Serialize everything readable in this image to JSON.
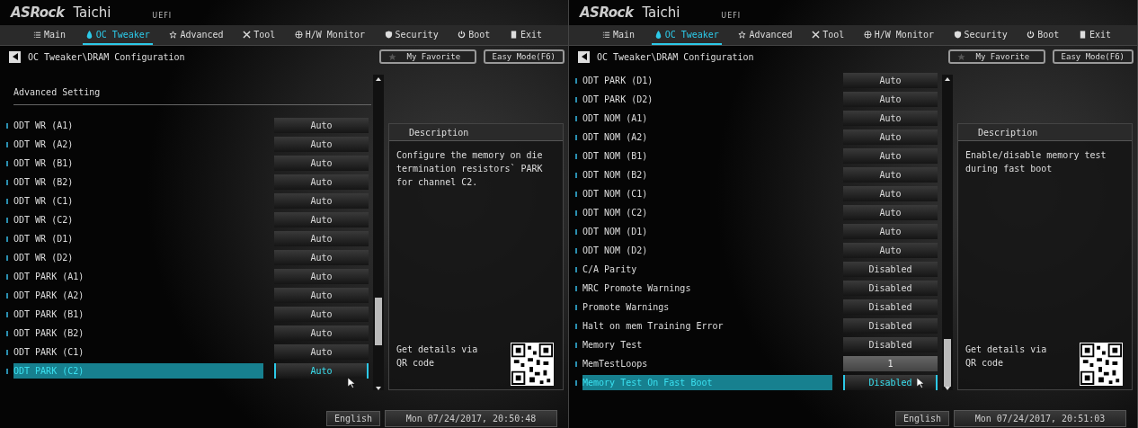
{
  "panels": [
    {
      "brand": "ASRock",
      "model": "Taichi",
      "firmware": "UEFI",
      "tabs": [
        {
          "label": "Main",
          "selected": false
        },
        {
          "label": "OC Tweaker",
          "selected": true
        },
        {
          "label": "Advanced",
          "selected": false
        },
        {
          "label": "Tool",
          "selected": false
        },
        {
          "label": "H/W Monitor",
          "selected": false
        },
        {
          "label": "Security",
          "selected": false
        },
        {
          "label": "Boot",
          "selected": false
        },
        {
          "label": "Exit",
          "selected": false
        }
      ],
      "breadcrumb": "OC Tweaker\\DRAM Configuration",
      "favorite_button": "My Favorite",
      "easy_mode_button": "Easy Mode(F6)",
      "section_heading": "Advanced Setting",
      "settings": [
        {
          "label": "ODT WR (A1)",
          "value": "Auto",
          "kind": "option",
          "selected": false
        },
        {
          "label": "ODT WR (A2)",
          "value": "Auto",
          "kind": "option",
          "selected": false
        },
        {
          "label": "ODT WR (B1)",
          "value": "Auto",
          "kind": "option",
          "selected": false
        },
        {
          "label": "ODT WR (B2)",
          "value": "Auto",
          "kind": "option",
          "selected": false
        },
        {
          "label": "ODT WR (C1)",
          "value": "Auto",
          "kind": "option",
          "selected": false
        },
        {
          "label": "ODT WR (C2)",
          "value": "Auto",
          "kind": "option",
          "selected": false
        },
        {
          "label": "ODT WR (D1)",
          "value": "Auto",
          "kind": "option",
          "selected": false
        },
        {
          "label": "ODT WR (D2)",
          "value": "Auto",
          "kind": "option",
          "selected": false
        },
        {
          "label": "ODT PARK (A1)",
          "value": "Auto",
          "kind": "option",
          "selected": false
        },
        {
          "label": "ODT PARK (A2)",
          "value": "Auto",
          "kind": "option",
          "selected": false
        },
        {
          "label": "ODT PARK (B1)",
          "value": "Auto",
          "kind": "option",
          "selected": false
        },
        {
          "label": "ODT PARK (B2)",
          "value": "Auto",
          "kind": "option",
          "selected": false
        },
        {
          "label": "ODT PARK (C1)",
          "value": "Auto",
          "kind": "option",
          "selected": false
        },
        {
          "label": "ODT PARK (C2)",
          "value": "Auto",
          "kind": "option",
          "selected": true
        }
      ],
      "description": {
        "title": "Description",
        "text": "Configure the memory on die termination resistors` PARK for channel C2."
      },
      "qr_caption": "Get details via QR code",
      "language": "English",
      "datetime": "Mon 07/24/2017, 20:50:48"
    },
    {
      "brand": "ASRock",
      "model": "Taichi",
      "firmware": "UEFI",
      "tabs": [
        {
          "label": "Main",
          "selected": false
        },
        {
          "label": "OC Tweaker",
          "selected": true
        },
        {
          "label": "Advanced",
          "selected": false
        },
        {
          "label": "Tool",
          "selected": false
        },
        {
          "label": "H/W Monitor",
          "selected": false
        },
        {
          "label": "Security",
          "selected": false
        },
        {
          "label": "Boot",
          "selected": false
        },
        {
          "label": "Exit",
          "selected": false
        }
      ],
      "breadcrumb": "OC Tweaker\\DRAM Configuration",
      "favorite_button": "My Favorite",
      "easy_mode_button": "Easy Mode(F6)",
      "settings": [
        {
          "label": "ODT PARK (D1)",
          "value": "Auto",
          "kind": "option",
          "selected": false
        },
        {
          "label": "ODT PARK (D2)",
          "value": "Auto",
          "kind": "option",
          "selected": false
        },
        {
          "label": "ODT NOM (A1)",
          "value": "Auto",
          "kind": "option",
          "selected": false
        },
        {
          "label": "ODT NOM (A2)",
          "value": "Auto",
          "kind": "option",
          "selected": false
        },
        {
          "label": "ODT NOM (B1)",
          "value": "Auto",
          "kind": "option",
          "selected": false
        },
        {
          "label": "ODT NOM (B2)",
          "value": "Auto",
          "kind": "option",
          "selected": false
        },
        {
          "label": "ODT NOM (C1)",
          "value": "Auto",
          "kind": "option",
          "selected": false
        },
        {
          "label": "ODT NOM (C2)",
          "value": "Auto",
          "kind": "option",
          "selected": false
        },
        {
          "label": "ODT NOM (D1)",
          "value": "Auto",
          "kind": "option",
          "selected": false
        },
        {
          "label": "ODT NOM (D2)",
          "value": "Auto",
          "kind": "option",
          "selected": false
        },
        {
          "label": "C/A Parity",
          "value": "Disabled",
          "kind": "option",
          "selected": false
        },
        {
          "label": "MRC Promote Warnings",
          "value": "Disabled",
          "kind": "option",
          "selected": false
        },
        {
          "label": "Promote Warnings",
          "value": "Disabled",
          "kind": "option",
          "selected": false
        },
        {
          "label": "Halt on mem Training Error",
          "value": "Disabled",
          "kind": "option",
          "selected": false
        },
        {
          "label": "Memory Test",
          "value": "Disabled",
          "kind": "option",
          "selected": false
        },
        {
          "label": "MemTestLoops",
          "value": "1",
          "kind": "number",
          "selected": false
        },
        {
          "label": "Memory Test On Fast Boot",
          "value": "Disabled",
          "kind": "option",
          "selected": true
        }
      ],
      "description": {
        "title": "Description",
        "text": "Enable/disable memory test during fast boot"
      },
      "qr_caption": "Get details via QR code",
      "language": "English",
      "datetime": "Mon 07/24/2017, 20:51:03"
    }
  ]
}
